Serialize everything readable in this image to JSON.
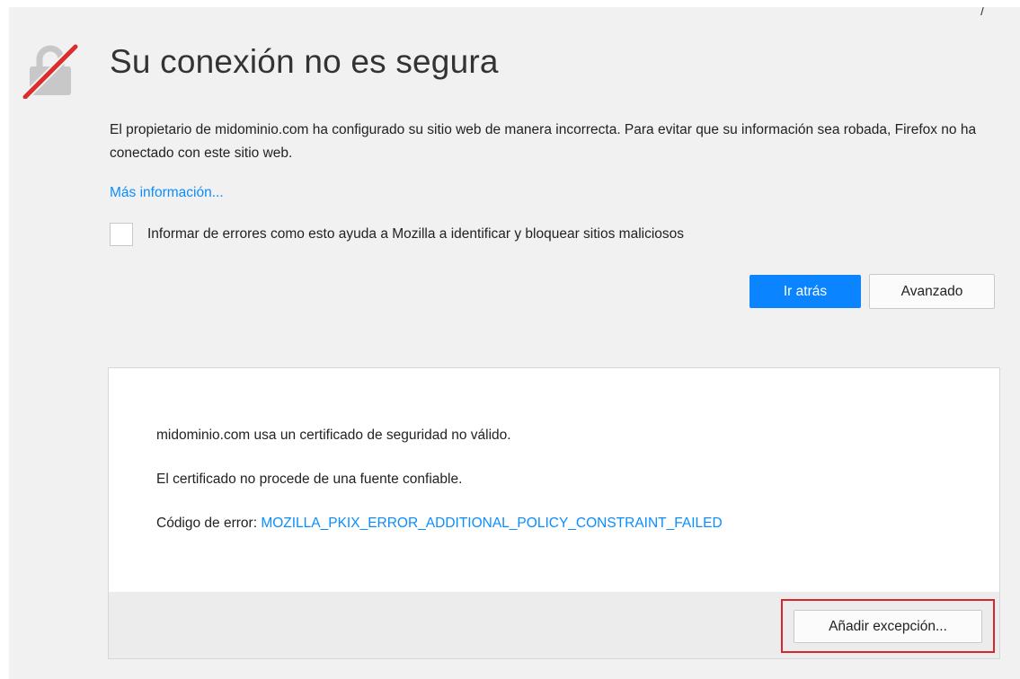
{
  "header": {
    "title": "Su conexión no es segura",
    "corner_mark": "/"
  },
  "icon": {
    "name": "broken-lock-icon",
    "lock_color": "#c8c8c8",
    "strike_color": "#d92e2e"
  },
  "main": {
    "description": "El propietario de midominio.com ha configurado su sitio web de manera incorrecta. Para evitar que su información sea robada, Firefox no ha conectado con este sitio web.",
    "more_info_link": "Más información...",
    "report_checkbox_label": "Informar de errores como esto ayuda a Mozilla a identificar y bloquear sitios maliciosos",
    "report_checkbox_checked": false
  },
  "buttons": {
    "go_back": "Ir atrás",
    "advanced": "Avanzado"
  },
  "details": {
    "cert_invalid": "midominio.com usa un certificado de seguridad no válido.",
    "cert_untrusted": "El certificado no procede de una fuente confiable.",
    "error_code_label": "Código de error: ",
    "error_code": "MOZILLA_PKIX_ERROR_ADDITIONAL_POLICY_CONSTRAINT_FAILED",
    "add_exception_button": "Añadir excepción..."
  },
  "colors": {
    "accent": "#0a84ff",
    "link": "#0a8dff",
    "highlight": "#d6272c",
    "page_background": "#f1f1f1"
  }
}
